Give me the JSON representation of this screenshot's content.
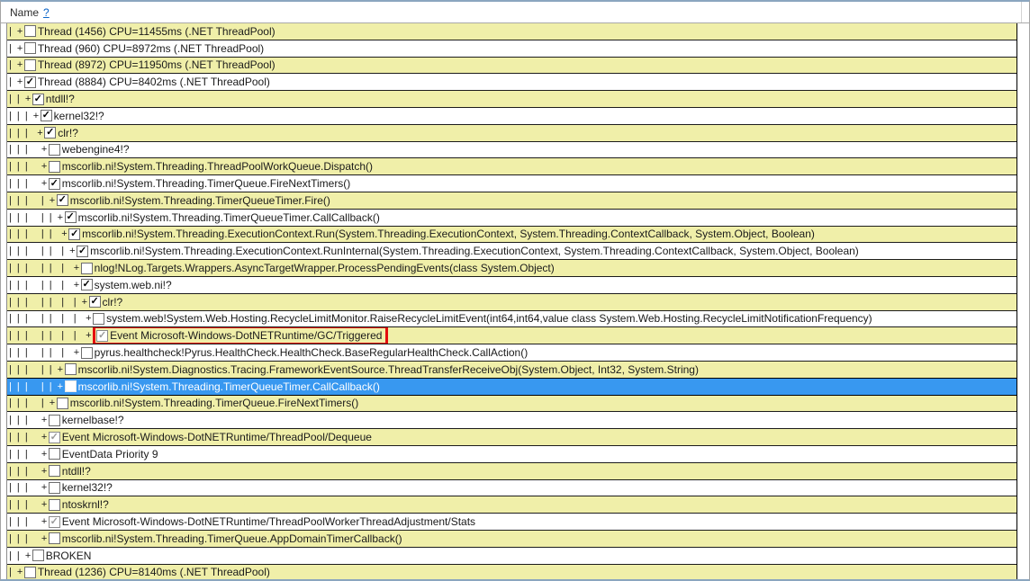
{
  "header": {
    "column_label": "Name",
    "help_link": "?"
  },
  "colors": {
    "row_highlight": "#f0efa9",
    "selection_blue": "#3898f0",
    "red_outline": "#e40d0d",
    "help_link_blue": "#0a64c8",
    "window_border": "#8ba6bf"
  },
  "rows": [
    {
      "prefix": "| +",
      "label": "Thread (1456) CPU=11455ms (.NET ThreadPool)",
      "check": "unchecked",
      "selected": false,
      "red_outline": false
    },
    {
      "prefix": "| +",
      "label": "Thread (960) CPU=8972ms (.NET ThreadPool)",
      "check": "unchecked",
      "selected": false,
      "red_outline": false
    },
    {
      "prefix": "| +",
      "label": "Thread (8972) CPU=11950ms (.NET ThreadPool)",
      "check": "unchecked",
      "selected": false,
      "red_outline": false
    },
    {
      "prefix": "| +",
      "label": "Thread (8884) CPU=8402ms (.NET ThreadPool)",
      "check": "checked",
      "selected": false,
      "red_outline": false
    },
    {
      "prefix": "| | +",
      "label": "ntdll!?",
      "check": "checked",
      "selected": false,
      "red_outline": false
    },
    {
      "prefix": "| | | +",
      "label": "kernel32!?",
      "check": "checked",
      "selected": false,
      "red_outline": false
    },
    {
      "prefix": "| | |  +",
      "label": "clr!?",
      "check": "checked",
      "selected": false,
      "red_outline": false
    },
    {
      "prefix": "| | |   +",
      "label": "webengine4!?",
      "check": "unchecked",
      "selected": false,
      "red_outline": false
    },
    {
      "prefix": "| | |   +",
      "label": "mscorlib.ni!System.Threading.ThreadPoolWorkQueue.Dispatch()",
      "check": "unchecked",
      "selected": false,
      "red_outline": false
    },
    {
      "prefix": "| | |   +",
      "label": "mscorlib.ni!System.Threading.TimerQueue.FireNextTimers()",
      "check": "checked",
      "selected": false,
      "red_outline": false
    },
    {
      "prefix": "| | |   | +",
      "label": "mscorlib.ni!System.Threading.TimerQueueTimer.Fire()",
      "check": "checked",
      "selected": false,
      "red_outline": false
    },
    {
      "prefix": "| | |   | | +",
      "label": "mscorlib.ni!System.Threading.TimerQueueTimer.CallCallback()",
      "check": "checked",
      "selected": false,
      "red_outline": false
    },
    {
      "prefix": "| | |   | |  +",
      "label": "mscorlib.ni!System.Threading.ExecutionContext.Run(System.Threading.ExecutionContext, System.Threading.ContextCallback, System.Object, Boolean)",
      "check": "checked",
      "selected": false,
      "red_outline": false
    },
    {
      "prefix": "| | |   | |  | +",
      "label": "mscorlib.ni!System.Threading.ExecutionContext.RunInternal(System.Threading.ExecutionContext, System.Threading.ContextCallback, System.Object, Boolean)",
      "check": "checked",
      "selected": false,
      "red_outline": false
    },
    {
      "prefix": "| | |   | |  |  +",
      "label": "nlog!NLog.Targets.Wrappers.AsyncTargetWrapper.ProcessPendingEvents(class System.Object)",
      "check": "unchecked",
      "selected": false,
      "red_outline": false
    },
    {
      "prefix": "| | |   | |  |  +",
      "label": "system.web.ni!?",
      "check": "checked",
      "selected": false,
      "red_outline": false
    },
    {
      "prefix": "| | |   | |  |  | +",
      "label": "clr!?",
      "check": "checked",
      "selected": false,
      "red_outline": false
    },
    {
      "prefix": "| | |   | |  |  |  +",
      "label": "system.web!System.Web.Hosting.RecycleLimitMonitor.RaiseRecycleLimitEvent(int64,int64,value class System.Web.Hosting.RecycleLimitNotificationFrequency)",
      "check": "unchecked",
      "selected": false,
      "red_outline": false
    },
    {
      "prefix": "| | |   | |  |  |  +",
      "label": "Event Microsoft-Windows-DotNETRuntime/GC/Triggered",
      "check": "checked-grey",
      "selected": false,
      "red_outline": true
    },
    {
      "prefix": "| | |   | |  |  +",
      "label": "pyrus.healthcheck!Pyrus.HealthCheck.HealthCheck.BaseRegularHealthCheck.CallAction()",
      "check": "unchecked",
      "selected": false,
      "red_outline": false
    },
    {
      "prefix": "| | |   | | +",
      "label": "mscorlib.ni!System.Diagnostics.Tracing.FrameworkEventSource.ThreadTransferReceiveObj(System.Object, Int32, System.String)",
      "check": "unchecked",
      "selected": false,
      "red_outline": false
    },
    {
      "prefix": "| | |   | | +",
      "label": "mscorlib.ni!System.Threading.TimerQueueTimer.CallCallback()",
      "check": "unchecked",
      "selected": true,
      "red_outline": false
    },
    {
      "prefix": "| | |   | +",
      "label": "mscorlib.ni!System.Threading.TimerQueue.FireNextTimers()",
      "check": "unchecked",
      "selected": false,
      "red_outline": false
    },
    {
      "prefix": "| | |   +",
      "label": "kernelbase!?",
      "check": "unchecked",
      "selected": false,
      "red_outline": false
    },
    {
      "prefix": "| | |   +",
      "label": "Event Microsoft-Windows-DotNETRuntime/ThreadPool/Dequeue",
      "check": "checked-grey",
      "selected": false,
      "red_outline": false
    },
    {
      "prefix": "| | |   +",
      "label": "EventData Priority 9",
      "check": "unchecked",
      "selected": false,
      "red_outline": false
    },
    {
      "prefix": "| | |   +",
      "label": "ntdll!?",
      "check": "unchecked",
      "selected": false,
      "red_outline": false
    },
    {
      "prefix": "| | |   +",
      "label": "kernel32!?",
      "check": "unchecked",
      "selected": false,
      "red_outline": false
    },
    {
      "prefix": "| | |   +",
      "label": "ntoskrnl!?",
      "check": "unchecked",
      "selected": false,
      "red_outline": false
    },
    {
      "prefix": "| | |   +",
      "label": "Event Microsoft-Windows-DotNETRuntime/ThreadPoolWorkerThreadAdjustment/Stats",
      "check": "checked-grey",
      "selected": false,
      "red_outline": false
    },
    {
      "prefix": "| | |   +",
      "label": "mscorlib.ni!System.Threading.TimerQueue.AppDomainTimerCallback()",
      "check": "unchecked",
      "selected": false,
      "red_outline": false
    },
    {
      "prefix": "| | +",
      "label": "BROKEN",
      "check": "unchecked",
      "selected": false,
      "red_outline": false
    },
    {
      "prefix": "| +",
      "label": "Thread (1236) CPU=8140ms (.NET ThreadPool)",
      "check": "unchecked",
      "selected": false,
      "red_outline": false
    }
  ]
}
